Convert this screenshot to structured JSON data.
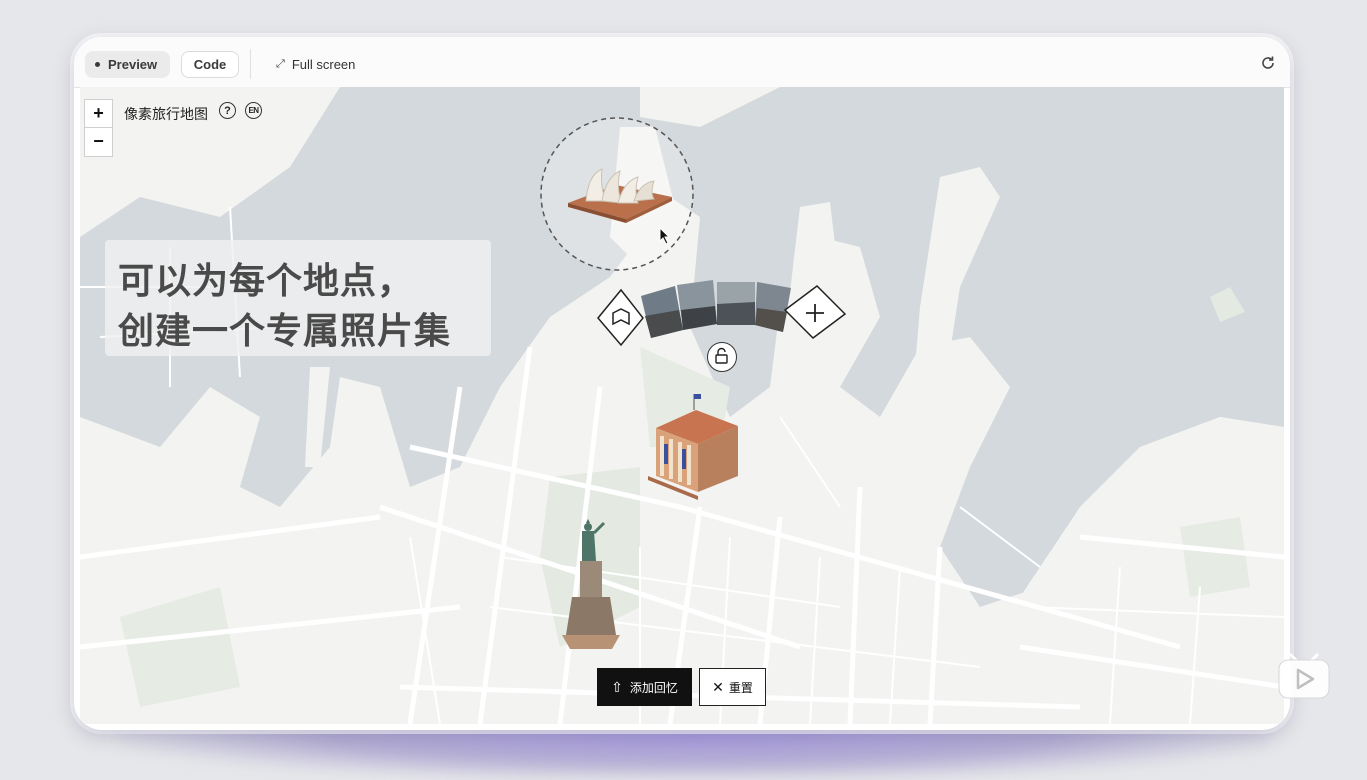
{
  "toolbar": {
    "preview_label": "Preview",
    "code_label": "Code",
    "fullscreen_label": "Full screen"
  },
  "map": {
    "title": "像素旅行地图",
    "help_label": "?",
    "lang_label": "EN",
    "zoom_in_label": "+",
    "zoom_out_label": "−"
  },
  "caption": {
    "line1": "可以为每个地点，",
    "line2": "创建一个专属照片集"
  },
  "actions": {
    "add_memory_label": "添加回忆",
    "reset_label": "重置"
  },
  "icons": {
    "landmarks": [
      "opera-house-icon",
      "museum-icon",
      "statue-icon"
    ],
    "carousel": [
      "book-icon",
      "photo-thumbnail",
      "plus-icon",
      "lock-icon"
    ]
  },
  "colors": {
    "water": "#d3d9dc",
    "land": "#f3f3f1",
    "park": "#e4eae2",
    "accent_dark": "#111111"
  }
}
